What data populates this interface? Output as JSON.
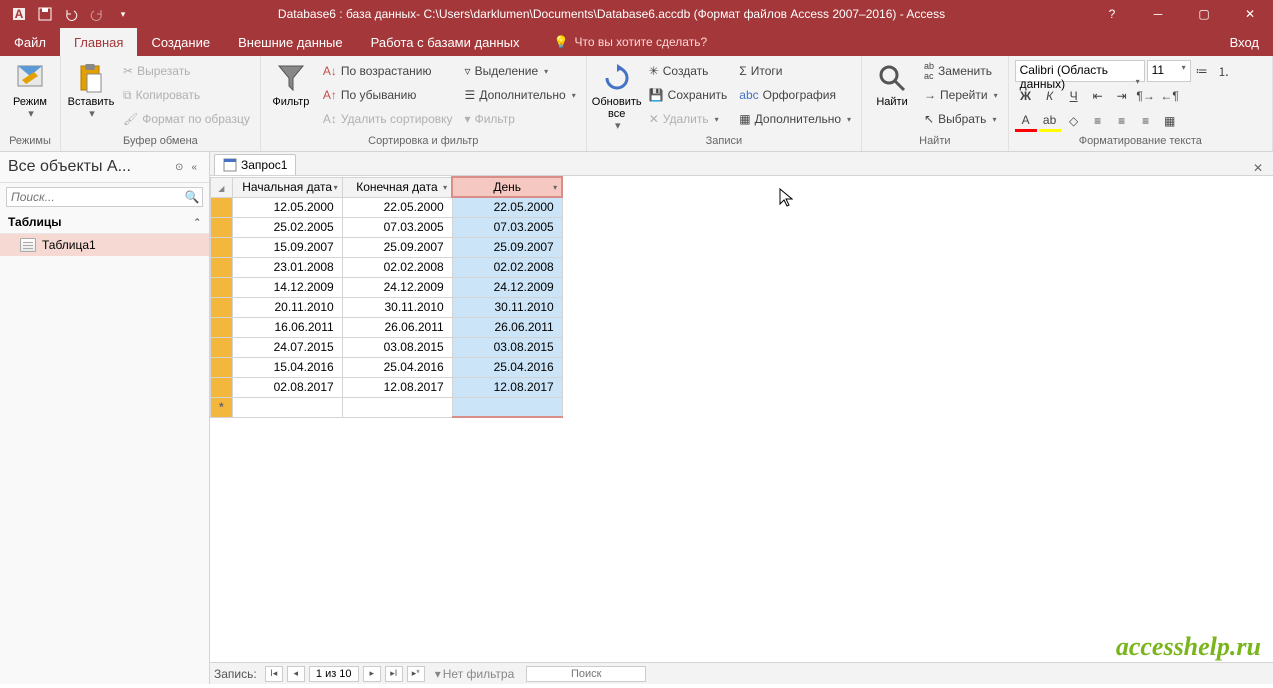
{
  "titlebar": {
    "title": "Database6 : база данных- C:\\Users\\darklumen\\Documents\\Database6.accdb (Формат файлов Access 2007–2016) - Access"
  },
  "menu": {
    "file": "Файл",
    "home": "Главная",
    "create": "Создание",
    "external": "Внешние данные",
    "dbwork": "Работа с базами данных",
    "tell": "Что вы хотите сделать?",
    "signin": "Вход"
  },
  "ribbon": {
    "views": {
      "mode": "Режим",
      "group": "Режимы"
    },
    "clipboard": {
      "paste": "Вставить",
      "cut": "Вырезать",
      "copy": "Копировать",
      "format": "Формат по образцу",
      "group": "Буфер обмена"
    },
    "sort": {
      "filter": "Фильтр",
      "asc": "По возрастанию",
      "desc": "По убыванию",
      "clear": "Удалить сортировку",
      "selection": "Выделение",
      "advanced": "Дополнительно",
      "toggle": "Фильтр",
      "group": "Сортировка и фильтр"
    },
    "records": {
      "refresh": "Обновить все",
      "new": "Создать",
      "save": "Сохранить",
      "delete": "Удалить",
      "totals": "Итоги",
      "spell": "Орфография",
      "more": "Дополнительно",
      "group": "Записи"
    },
    "find": {
      "find": "Найти",
      "replace": "Заменить",
      "goto": "Перейти",
      "select": "Выбрать",
      "group": "Найти"
    },
    "format": {
      "font": "Calibri (Область данных)",
      "size": "11",
      "group": "Форматирование текста"
    }
  },
  "nav": {
    "header": "Все объекты A...",
    "search_ph": "Поиск...",
    "group_tables": "Таблицы",
    "table1": "Таблица1"
  },
  "doc": {
    "tab": "Запрос1"
  },
  "grid": {
    "columns": [
      "Начальная дата",
      "Конечная дата",
      "День"
    ],
    "rows": [
      [
        "12.05.2000",
        "22.05.2000",
        "22.05.2000"
      ],
      [
        "25.02.2005",
        "07.03.2005",
        "07.03.2005"
      ],
      [
        "15.09.2007",
        "25.09.2007",
        "25.09.2007"
      ],
      [
        "23.01.2008",
        "02.02.2008",
        "02.02.2008"
      ],
      [
        "14.12.2009",
        "24.12.2009",
        "24.12.2009"
      ],
      [
        "20.11.2010",
        "30.11.2010",
        "30.11.2010"
      ],
      [
        "16.06.2011",
        "26.06.2011",
        "26.06.2011"
      ],
      [
        "24.07.2015",
        "03.08.2015",
        "03.08.2015"
      ],
      [
        "15.04.2016",
        "25.04.2016",
        "25.04.2016"
      ],
      [
        "02.08.2017",
        "12.08.2017",
        "12.08.2017"
      ]
    ]
  },
  "recnav": {
    "label": "Запись:",
    "pos": "1 из 10",
    "nofilter": "Нет фильтра",
    "search": "Поиск"
  },
  "watermark": "accesshelp.ru"
}
